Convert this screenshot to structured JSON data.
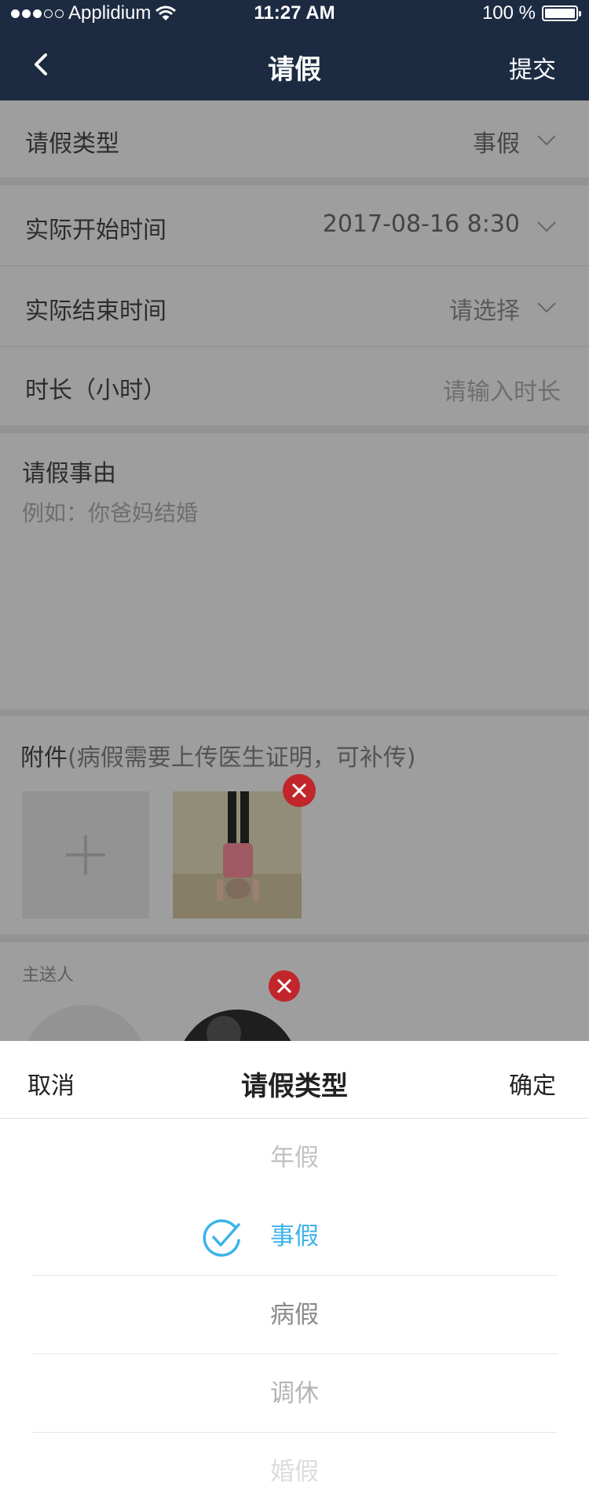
{
  "status_bar": {
    "carrier": "Applidium",
    "time": "11:27 AM",
    "battery": "100 %"
  },
  "nav": {
    "title": "请假",
    "submit": "提交"
  },
  "form": {
    "leave_type": {
      "label": "请假类型",
      "value": "事假"
    },
    "start_time": {
      "label": "实际开始时间",
      "value": "2017-08-16 8:30"
    },
    "end_time": {
      "label": "实际结束时间",
      "value": "请选择"
    },
    "duration": {
      "label": "时长（小时）",
      "placeholder": "请输入时长"
    },
    "reason": {
      "label": "请假事由",
      "placeholder": "例如：你爸妈结婚"
    },
    "attachments": {
      "label": "附件",
      "hint": "(病假需要上传医生证明，可补传)"
    },
    "recipients": {
      "label": "主送人"
    }
  },
  "picker": {
    "cancel": "取消",
    "title": "请假类型",
    "confirm": "确定",
    "options": [
      "年假",
      "事假",
      "病假",
      "调休",
      "婚假"
    ],
    "selected": "事假"
  },
  "colors": {
    "nav_bg": "#1d2b42",
    "accent": "#3bb4ea",
    "delete": "#c0262b"
  }
}
